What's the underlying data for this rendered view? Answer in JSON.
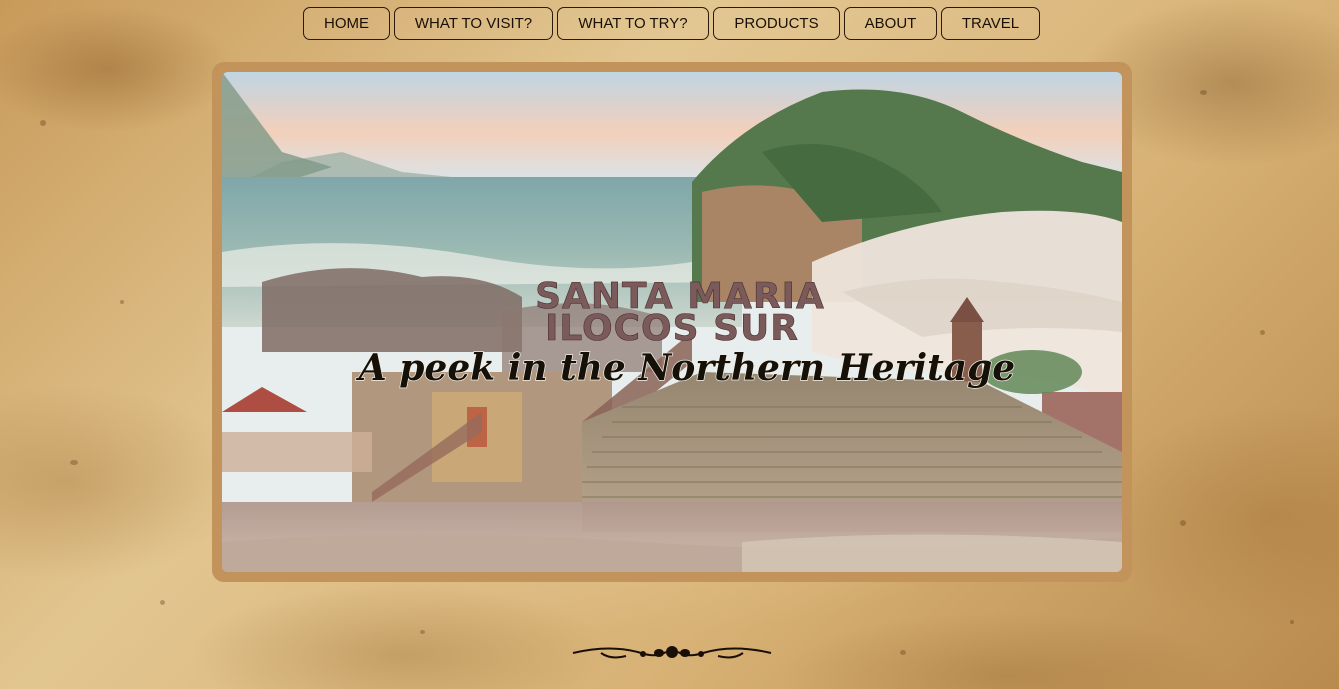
{
  "nav": {
    "items": [
      {
        "label": "HOME"
      },
      {
        "label": "WHAT TO VISIT?"
      },
      {
        "label": "WHAT TO TRY?"
      },
      {
        "label": "PRODUCTS"
      },
      {
        "label": "ABOUT"
      },
      {
        "label": "TRAVEL"
      }
    ]
  },
  "banner": {
    "title_line1": "SANTA MARIA",
    "title_line2": "ILOCOS SUR",
    "tagline": "A peek in the Northern Heritage",
    "image_desc_icon": "landscape-collage-image"
  },
  "footer": {
    "ornament_icon": "ornamental-divider-icon"
  },
  "colors": {
    "frame": "#c2935a",
    "nav_border": "#2a1a0a",
    "title_fill": "#7a5a5a",
    "tagline": "#151008"
  }
}
